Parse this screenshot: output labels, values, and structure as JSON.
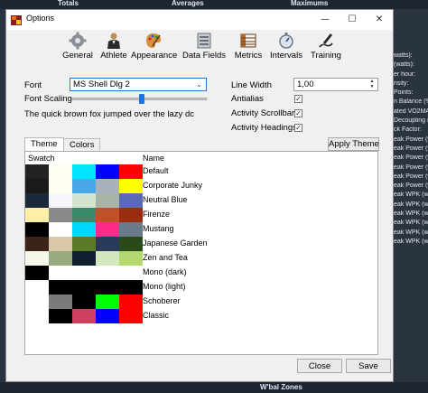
{
  "background": {
    "top_labels": [
      "Totals",
      "Averages",
      "Maximums"
    ],
    "right_labels": [
      "watts):",
      "(watts):",
      "er hour:",
      "nsity:",
      "Points:",
      "n Balance (%",
      "ated VO2MAX",
      "Decoupling (",
      "ck Factor:",
      "eak Power (w",
      "eak Power (w",
      "eak Power (w",
      "eak Power (w",
      "eak Power (w",
      "eak Power (w",
      "eak WPK (w/k",
      "eak WPK (w/k",
      "eak WPK (w/k",
      "eak WPK (w/k",
      "eak WPK (w/k",
      "eak WPK (w/k"
    ],
    "bottom_label": "W'bal Zones"
  },
  "window": {
    "title": "Options",
    "minimize": "—",
    "maximize": "☐",
    "close": "✕"
  },
  "toolbar": {
    "items": [
      {
        "label": "General",
        "icon": "gear-icon"
      },
      {
        "label": "Athlete",
        "icon": "athlete-icon"
      },
      {
        "label": "Appearance",
        "icon": "palette-icon"
      },
      {
        "label": "Data Fields",
        "icon": "data-fields-icon"
      },
      {
        "label": "Metrics",
        "icon": "metrics-icon"
      },
      {
        "label": "Intervals",
        "icon": "stopwatch-icon"
      },
      {
        "label": "Training",
        "icon": "training-icon"
      }
    ]
  },
  "font": {
    "label": "Font",
    "value": "MS Shell Dlg 2",
    "scaling_label": "Font Scaling",
    "scaling_value": 0.52,
    "preview": "The quick brown fox jumped over the lazy dc"
  },
  "line_width": {
    "label": "Line Width",
    "value": "1,00"
  },
  "checks": [
    {
      "label": "Antialias",
      "checked": true,
      "mark": "✓"
    },
    {
      "label": "Activity Scrollbar",
      "checked": true,
      "mark": "✓"
    },
    {
      "label": "Activity Headings",
      "checked": true,
      "mark": "✓"
    }
  ],
  "tabs": [
    "Theme",
    "Colors"
  ],
  "apply_theme": "Apply Theme",
  "table": {
    "headers": [
      "Swatch",
      "Name"
    ],
    "rows": [
      {
        "name": "Default",
        "colors": [
          "#222222",
          "#fffff0",
          "#00e5ff",
          "#0000ff",
          "#ff0000"
        ]
      },
      {
        "name": "Corporate Junky",
        "colors": [
          "#1a1a1a",
          "#fffff0",
          "#4aa8e8",
          "#aab0bc",
          "#ffff00"
        ]
      },
      {
        "name": "Neutral Blue",
        "colors": [
          "#1a2a3a",
          "#f4f6fa",
          "#d4e4d0",
          "#a8b4a8",
          "#5a6ab8"
        ]
      },
      {
        "name": "Firenze",
        "colors": [
          "#ffeea8",
          "#8a8a8a",
          "#3a8a6a",
          "#c05028",
          "#9a2a10"
        ]
      },
      {
        "name": "Mustang",
        "colors": [
          "#000000",
          "#ffffff",
          "#00d8ff",
          "#ff2a8a",
          "#6a7a8a"
        ]
      },
      {
        "name": "Japanese Garden",
        "colors": [
          "#3a2418",
          "#d8c8a8",
          "#5a7a2a",
          "#2a3a5a",
          "#2a4a1a"
        ]
      },
      {
        "name": "Zen and Tea",
        "colors": [
          "#f4f8e8",
          "#9aaa80",
          "#102030",
          "#d4e8c0",
          "#b4d870"
        ]
      },
      {
        "name": "Mono (dark)",
        "colors": [
          "#000000",
          "#ffffff",
          "#ffffff",
          "#ffffff",
          "#ffffff"
        ]
      },
      {
        "name": "Mono (light)",
        "colors": [
          "#ffffff",
          "#000000",
          "#000000",
          "#000000",
          "#000000"
        ]
      },
      {
        "name": "Schoberer",
        "colors": [
          "#ffffff",
          "#7a7a7a",
          "#000000",
          "#00ff00",
          "#ff0000"
        ]
      },
      {
        "name": "Classic",
        "colors": [
          "#ffffff",
          "#000000",
          "#d04060",
          "#0000ff",
          "#ff0000"
        ]
      }
    ]
  },
  "buttons": {
    "close": "Close",
    "save": "Save"
  }
}
